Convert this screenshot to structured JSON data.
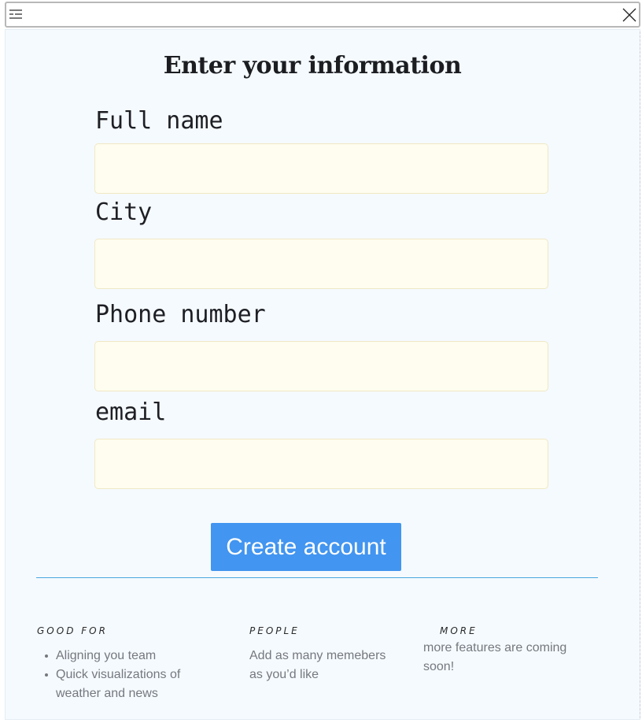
{
  "form": {
    "title": "Enter your information",
    "fields": [
      {
        "label": "Full name",
        "value": ""
      },
      {
        "label": "City",
        "value": ""
      },
      {
        "label": "Phone number",
        "value": ""
      },
      {
        "label": "email",
        "value": ""
      }
    ],
    "submit_label": "Create account"
  },
  "footer": {
    "good_for": {
      "heading": "GOOD FOR",
      "items": [
        "Aligning you team",
        "Quick visualizations of weather and news"
      ]
    },
    "people": {
      "heading": "PEOPLE",
      "text": "Add as many memebers as you’d like"
    },
    "more": {
      "heading": "MORE",
      "text": "more features are coming soon!"
    }
  },
  "colors": {
    "button": "#4295f0",
    "field_background": "#fefdef",
    "panel_background": "#f5faff",
    "divider": "#4aa8e0"
  },
  "icons": [
    "menu-icon",
    "close-icon"
  ]
}
